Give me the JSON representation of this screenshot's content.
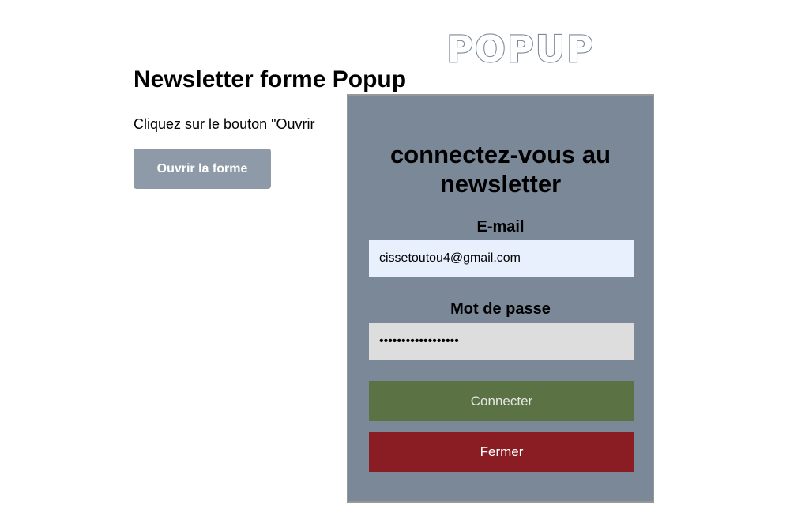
{
  "logo": {
    "text": "POPUP"
  },
  "page": {
    "title": "Newsletter forme Popup",
    "instructions": "Cliquez sur le bouton \"Ouvrir"
  },
  "open_button": {
    "label": "Ouvrir la forme"
  },
  "popup": {
    "title_line1": "connectez-vous au",
    "title_line2": "newsletter",
    "email_label": "E-mail",
    "email_value": "cissetoutou4@gmail.com",
    "password_label": "Mot de passe",
    "password_value": "••••••••••••••••••",
    "submit_label": "Connecter",
    "close_label": "Fermer"
  },
  "colors": {
    "popup_background": "#7b8898",
    "open_button": "#8e9aa7",
    "submit_button": "#5a7244",
    "close_button": "#8a1c23",
    "email_field": "#e8f0fe",
    "password_field": "#dddddd"
  }
}
